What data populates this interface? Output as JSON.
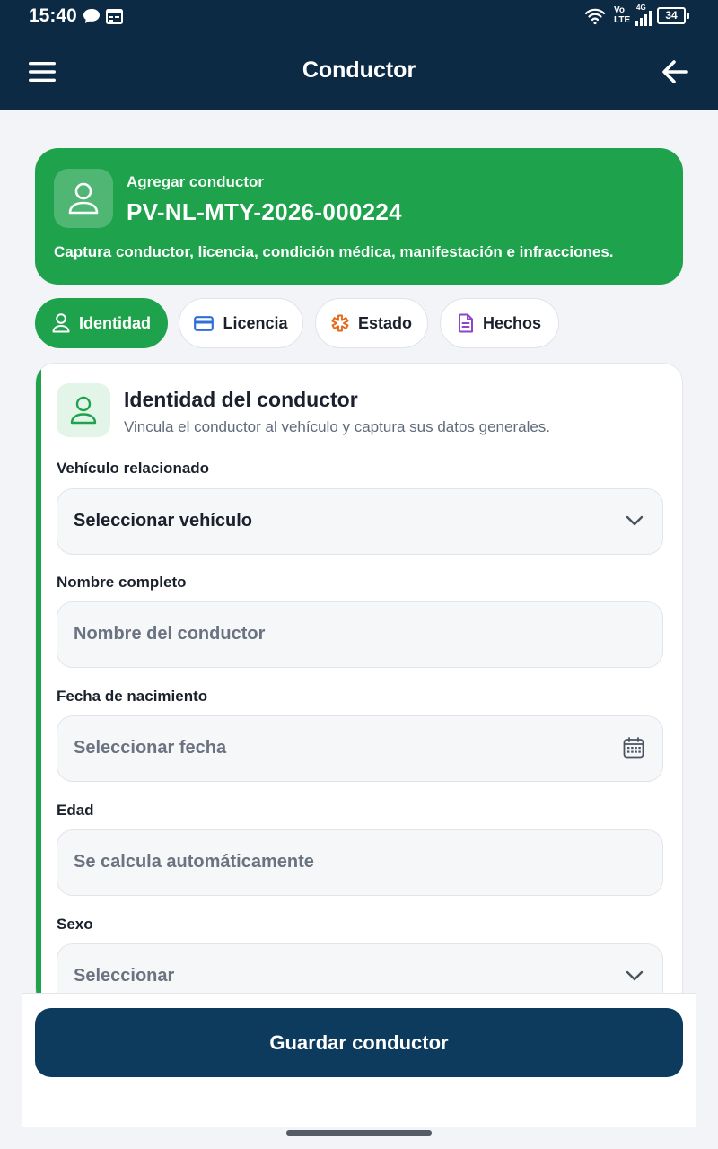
{
  "status_bar": {
    "time": "15:40",
    "network_top": "Vo",
    "network_bottom": "LTE",
    "network_gen": "4G",
    "battery": "34"
  },
  "app_bar": {
    "title": "Conductor",
    "menu_icon": "hamburger-menu-icon",
    "back_icon": "arrow-left-icon"
  },
  "banner": {
    "subtitle": "Agregar conductor",
    "folio": "PV-NL-MTY-2026-000224",
    "description": "Captura conductor, licencia, condición médica, manifestación e infracciones.",
    "color": "#1ea34c"
  },
  "tabs": [
    {
      "label": "Identidad",
      "icon": "user-icon",
      "active": true
    },
    {
      "label": "Licencia",
      "icon": "card-icon",
      "active": false
    },
    {
      "label": "Estado",
      "icon": "medical-asterisk-icon",
      "active": false
    },
    {
      "label": "Hechos",
      "icon": "document-icon",
      "active": false
    }
  ],
  "section": {
    "title": "Identidad del conductor",
    "subtitle": "Vincula el conductor al vehículo y captura sus datos generales."
  },
  "fields": {
    "vehicle": {
      "label": "Vehículo relacionado",
      "value": "Seleccionar vehículo"
    },
    "name": {
      "label": "Nombre completo",
      "placeholder": "Nombre del conductor"
    },
    "birthdate": {
      "label": "Fecha de nacimiento",
      "placeholder": "Seleccionar fecha"
    },
    "age": {
      "label": "Edad",
      "placeholder": "Se calcula automáticamente"
    },
    "sex": {
      "label": "Sexo",
      "placeholder": "Seleccionar"
    }
  },
  "actions": {
    "save_label": "Guardar conductor"
  },
  "colors": {
    "primary_dark": "#0d2a45",
    "accent_green": "#1ea34c",
    "button": "#0d3b5e"
  }
}
